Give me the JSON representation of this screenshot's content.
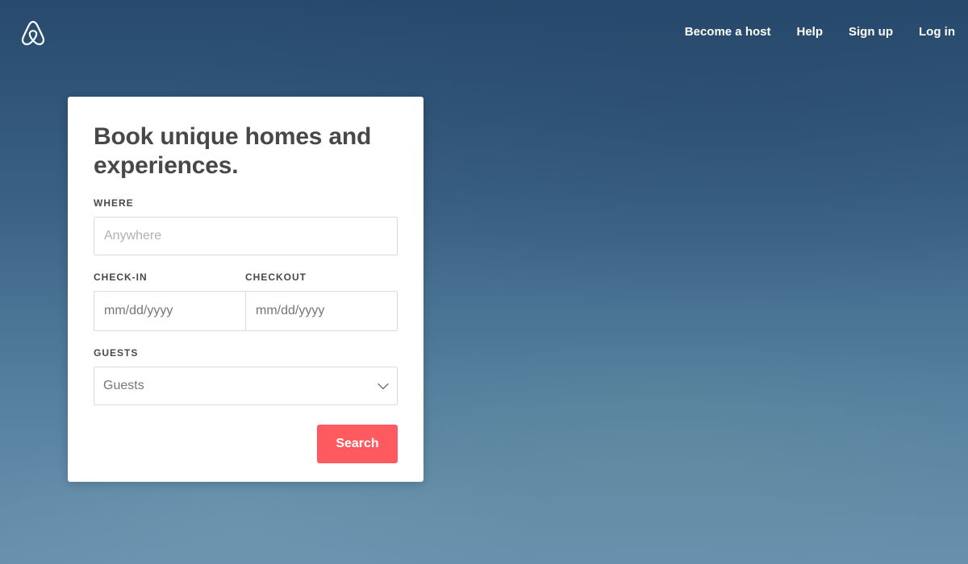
{
  "header": {
    "logo_icon": "airbnb-belo-icon",
    "nav": [
      {
        "label": "Become a host"
      },
      {
        "label": "Help"
      },
      {
        "label": "Sign up"
      },
      {
        "label": "Log in"
      }
    ]
  },
  "search_card": {
    "title": "Book unique homes and experiences.",
    "where": {
      "label": "WHERE",
      "placeholder": "Anywhere"
    },
    "check_in": {
      "label": "CHECK-IN",
      "placeholder": "mm/dd/yyyy"
    },
    "checkout": {
      "label": "CHECKOUT",
      "placeholder": "mm/dd/yyyy"
    },
    "guests": {
      "label": "GUESTS",
      "selected": "Guests",
      "icon": "chevron-down-icon"
    },
    "search_button": "Search"
  },
  "colors": {
    "accent": "#ff5a5f",
    "heading_text": "#484848",
    "border": "#dbdbdb",
    "background_top": "#274a6d",
    "background_bottom": "#6991ae"
  }
}
